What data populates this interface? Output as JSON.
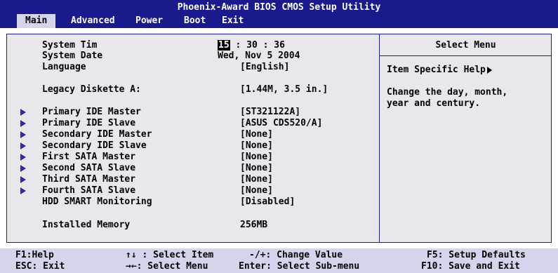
{
  "title": "Phoenix-Award BIOS CMOS Setup Utility",
  "menu": {
    "tabs": [
      "Main",
      "Advanced",
      "Power",
      "Boot",
      "Exit"
    ],
    "active": "Main"
  },
  "fields": {
    "system_time": {
      "label": "System Tim",
      "hour": "15",
      "rest": ": 30 : 36"
    },
    "system_date": {
      "label": "System Date",
      "value": "Wed, Nov 5 2004"
    },
    "language": {
      "label": "Language",
      "value": "[English]"
    },
    "legacy_diskette": {
      "label": "Legacy Diskette A:",
      "value": "[1.44M, 3.5 in.]"
    },
    "primary_ide_master": {
      "label": "Primary IDE Master",
      "value": "[ST321122A]"
    },
    "primary_ide_slave": {
      "label": "Primary IDE Slave",
      "value": "[ASUS CDS520/A]"
    },
    "secondary_ide_master": {
      "label": "Secondary IDE Master",
      "value": "[None]"
    },
    "secondary_ide_slave": {
      "label": "Secondary IDE Slave",
      "value": "[None]"
    },
    "first_sata_master": {
      "label": "First SATA Master",
      "value": "[None]"
    },
    "second_sata_slave": {
      "label": "Second SATA Slave",
      "value": "[None]"
    },
    "third_sata_master": {
      "label": "Third SATA Master",
      "value": "[None]"
    },
    "fourth_sata_slave": {
      "label": "Fourth SATA Slave",
      "value": "[None]"
    },
    "hdd_smart": {
      "label": "HDD SMART Monitoring",
      "value": "[Disabled]"
    },
    "installed_memory": {
      "label": "Installed Memory",
      "value": "256MB"
    }
  },
  "help": {
    "title": "Select Menu",
    "item_specific": "Item Specific Help",
    "text": "Change the day, month,\nyear and century."
  },
  "footer": {
    "f1": "F1:Help",
    "esc": "ESC: Exit",
    "select_item": "↑↓ : Select Item",
    "select_menu": "→←: Select Menu",
    "change_value": "-/+: Change Value",
    "select_submenu": "Enter: Select Sub-menu",
    "f5": "F5: Setup Defaults",
    "f10": "F10: Save and Exit"
  },
  "colors": {
    "bar_blue": "#1a1a8c",
    "panel": "#e8e8ec",
    "footer": "#d4d4ec",
    "arrow": "#2a2aa8"
  }
}
